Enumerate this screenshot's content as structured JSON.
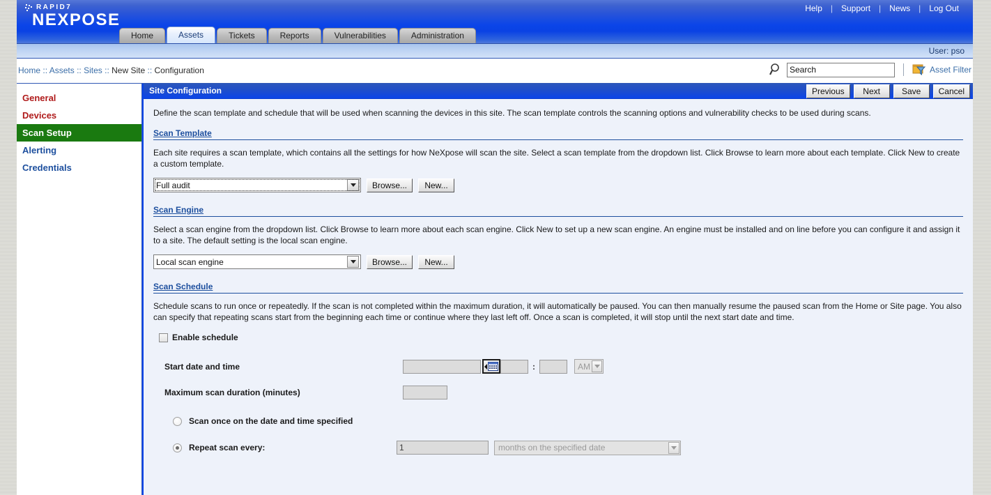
{
  "brand": {
    "company": "RAPID7",
    "product": "NEXPOSE"
  },
  "util_links": [
    {
      "label": "Help"
    },
    {
      "label": "Support"
    },
    {
      "label": "News"
    },
    {
      "label": "Log Out"
    }
  ],
  "tabs": [
    {
      "label": "Home",
      "active": false
    },
    {
      "label": "Assets",
      "active": true
    },
    {
      "label": "Tickets",
      "active": false
    },
    {
      "label": "Reports",
      "active": false
    },
    {
      "label": "Vulnerabilities",
      "active": false
    },
    {
      "label": "Administration",
      "active": false
    }
  ],
  "user_row": {
    "user_label": "User: pso"
  },
  "breadcrumb": {
    "items": [
      "Home",
      "Assets",
      "Sites",
      "New Site",
      "Configuration"
    ],
    "separator": "::",
    "full": "Home :: Assets :: Sites :: New Site :: Configuration",
    "part_home": "Home",
    "part_assets": "Assets",
    "part_sites": "Sites",
    "part_newsite": "New Site",
    "part_configuration": "Configuration"
  },
  "search": {
    "value": "Search",
    "placeholder": "Search",
    "icon": "search-icon",
    "asset_filter_label": "Asset Filter",
    "asset_filter_icon": "funnel-filter-icon"
  },
  "sidebar": {
    "items": [
      {
        "label": "General",
        "state": "link-red",
        "active": false
      },
      {
        "label": "Devices",
        "state": "link-red",
        "active": false
      },
      {
        "label": "Scan Setup",
        "state": "active",
        "active": true
      },
      {
        "label": "Alerting",
        "state": "link-blue",
        "active": false
      },
      {
        "label": "Credentials",
        "state": "link-blue",
        "active": false
      }
    ]
  },
  "content": {
    "title": "Site Configuration",
    "buttons": [
      {
        "label": "Previous"
      },
      {
        "label": "Next"
      },
      {
        "label": "Save"
      },
      {
        "label": "Cancel"
      }
    ],
    "intro": "Define the scan template and schedule that will be used when scanning the devices in this site. The scan template controls the scanning options and vulnerability checks to be used during scans.",
    "scan_template": {
      "heading": "Scan Template",
      "description": "Each site requires a scan template, which contains all the settings for how NeXpose will scan the site. Select a scan template from the dropdown list. Click Browse to learn more about each template. Click New to create a custom template.",
      "selected": "Full audit",
      "browse_label": "Browse...",
      "new_label": "New..."
    },
    "scan_engine": {
      "heading": "Scan Engine",
      "description": "Select a scan engine from the dropdown list. Click Browse to learn more about each scan engine. Click New to set up a new scan engine. An engine must be installed and on line before you can configure it and assign it to a site. The default setting is the local scan engine.",
      "selected": "Local scan engine",
      "browse_label": "Browse...",
      "new_label": "New..."
    },
    "scan_schedule": {
      "heading": "Scan Schedule",
      "description": "Schedule scans to run once or repeatedly. If the scan is not completed within the maximum duration, it will automatically be paused. You can then manually resume the paused scan from the Home or Site page. You also can specify that repeating scans start from the beginning each time or continue where they last left off. Once a scan is completed, it will stop until the next start date and time.",
      "enable_checkbox_label": "Enable schedule",
      "enable_checked": false,
      "start_label": "Start date and time",
      "start_date_value": "",
      "start_hour_value": "",
      "start_minute_value": "",
      "time_separator": ":",
      "ampm_value": "AM",
      "calendar_icon": "calendar-picker-icon",
      "duration_label": "Maximum scan duration (minutes)",
      "duration_value": "",
      "scan_once_label": "Scan once on the date and time specified",
      "scan_once_selected": false,
      "repeat_label": "Repeat scan every:",
      "repeat_selected": true,
      "repeat_interval_value": "1",
      "repeat_unit_value": "months on the specified date"
    }
  },
  "colors": {
    "brand_blue": "#0b45e8",
    "active_green": "#1a7a10",
    "link_red": "#b01b1b",
    "link_blue": "#1d4f9e",
    "panel_bg": "#eef2fa"
  }
}
